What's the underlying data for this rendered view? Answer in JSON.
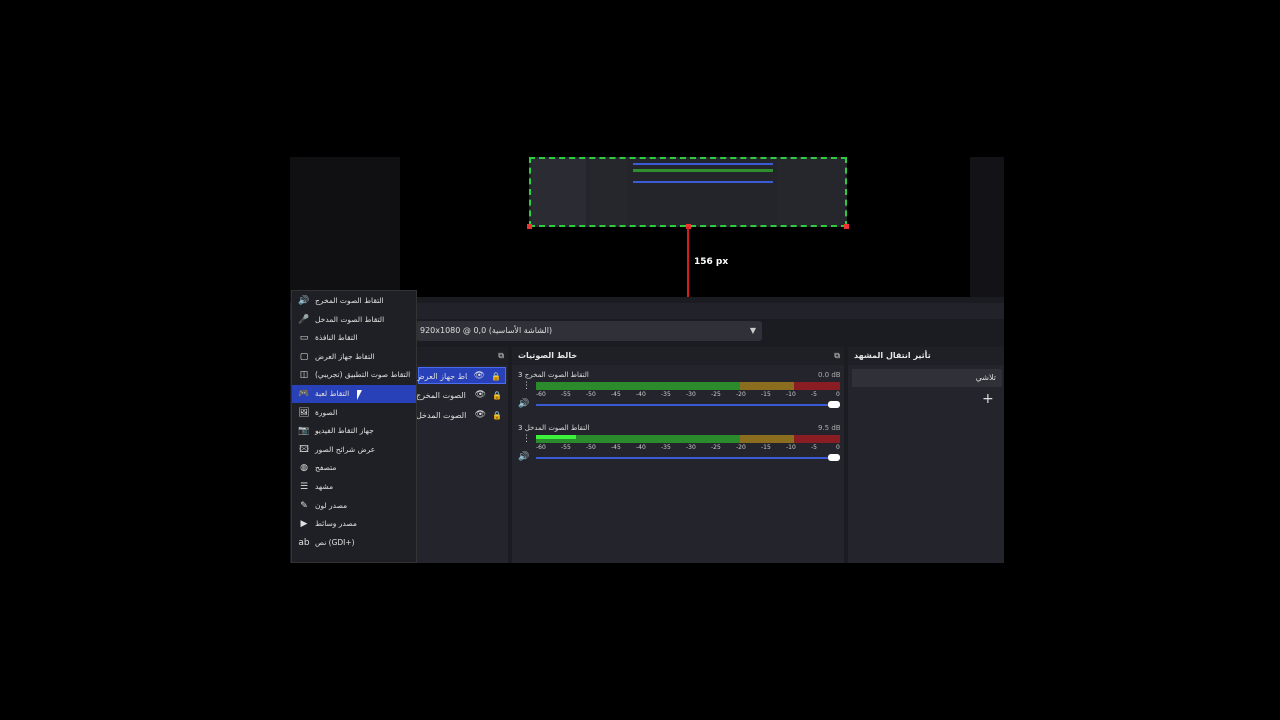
{
  "preview": {
    "guide_label": "156 px"
  },
  "scene_selector": {
    "value": "920x1080 @ 0,0 (الشاشة الأساسية)"
  },
  "mixer": {
    "title": "خالط الصوتيات",
    "channels": [
      {
        "name": "التقاط الصوت المخرج 3",
        "db": "0.0 dB",
        "level": 0.0
      },
      {
        "name": "التقاط الصوت المدخل 3",
        "db": "9.5 dB",
        "level": 0.13
      }
    ],
    "ticks": [
      "-60",
      "-55",
      "-50",
      "-45",
      "-40",
      "-35",
      "-30",
      "-25",
      "-20",
      "-15",
      "-10",
      "-5",
      "0"
    ]
  },
  "transitions": {
    "title": "تأثير انتقال المشهد",
    "value": "تلاشي",
    "add_label": "+"
  },
  "sources": [
    {
      "label": "التقاط جهاز العرض",
      "selected": true
    },
    {
      "label": "التقاط الصوت المخرج",
      "selected": false
    },
    {
      "label": "التقاط الصوت المدخل",
      "selected": false
    }
  ],
  "context_menu": [
    {
      "icon": "🔊",
      "label": "التقاط الصوت المخرج"
    },
    {
      "icon": "🎤",
      "label": "التقاط الصوت المدخل"
    },
    {
      "icon": "▭",
      "label": "التقاط النافذة"
    },
    {
      "icon": "▢",
      "label": "التقاط جهاز العرض"
    },
    {
      "icon": "◫",
      "label": "التقاط صوت التطبيق (تجريبي)"
    },
    {
      "icon": "🎮",
      "label": "التقاط لعبة",
      "highlight": true
    },
    {
      "icon": "🖼",
      "label": "الصورة"
    },
    {
      "icon": "📷",
      "label": "جهاز التقاط الفيديو"
    },
    {
      "icon": "🖾",
      "label": "عرض شرائح الصور"
    },
    {
      "icon": "◍",
      "label": "متصفح"
    },
    {
      "icon": "☰",
      "label": "مشهد"
    },
    {
      "icon": "✎",
      "label": "مصدر لون"
    },
    {
      "icon": "▶",
      "label": "مصدر وسائط"
    },
    {
      "icon": "ab",
      "label": "نص (GDI+)"
    }
  ]
}
